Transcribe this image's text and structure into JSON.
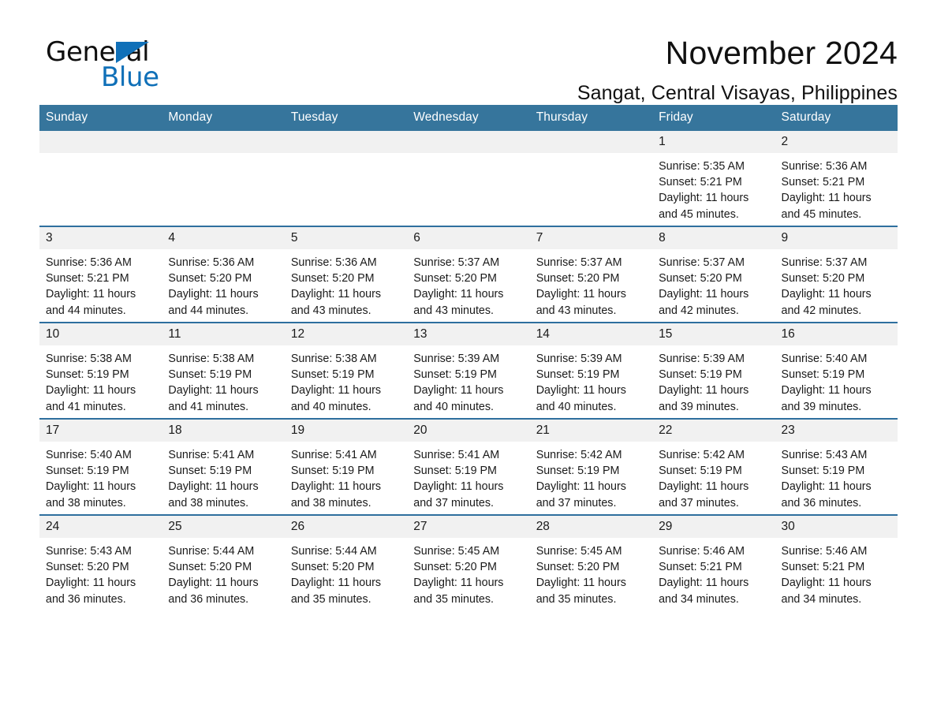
{
  "brand": {
    "name_part1": "General",
    "name_part2": "Blue",
    "accent_color": "#1070b8"
  },
  "header": {
    "title": "November 2024",
    "location": "Sangat, Central Visayas, Philippines"
  },
  "calendar": {
    "header_bg": "#36759c",
    "row_border_color": "#2e6f9e",
    "daynum_bg": "#f1f1f1",
    "weekdays": [
      "Sunday",
      "Monday",
      "Tuesday",
      "Wednesday",
      "Thursday",
      "Friday",
      "Saturday"
    ],
    "weeks": [
      [
        {
          "day": ""
        },
        {
          "day": ""
        },
        {
          "day": ""
        },
        {
          "day": ""
        },
        {
          "day": ""
        },
        {
          "day": "1",
          "sunrise": "Sunrise: 5:35 AM",
          "sunset": "Sunset: 5:21 PM",
          "daylight_line1": "Daylight: 11 hours",
          "daylight_line2": "and 45 minutes."
        },
        {
          "day": "2",
          "sunrise": "Sunrise: 5:36 AM",
          "sunset": "Sunset: 5:21 PM",
          "daylight_line1": "Daylight: 11 hours",
          "daylight_line2": "and 45 minutes."
        }
      ],
      [
        {
          "day": "3",
          "sunrise": "Sunrise: 5:36 AM",
          "sunset": "Sunset: 5:21 PM",
          "daylight_line1": "Daylight: 11 hours",
          "daylight_line2": "and 44 minutes."
        },
        {
          "day": "4",
          "sunrise": "Sunrise: 5:36 AM",
          "sunset": "Sunset: 5:20 PM",
          "daylight_line1": "Daylight: 11 hours",
          "daylight_line2": "and 44 minutes."
        },
        {
          "day": "5",
          "sunrise": "Sunrise: 5:36 AM",
          "sunset": "Sunset: 5:20 PM",
          "daylight_line1": "Daylight: 11 hours",
          "daylight_line2": "and 43 minutes."
        },
        {
          "day": "6",
          "sunrise": "Sunrise: 5:37 AM",
          "sunset": "Sunset: 5:20 PM",
          "daylight_line1": "Daylight: 11 hours",
          "daylight_line2": "and 43 minutes."
        },
        {
          "day": "7",
          "sunrise": "Sunrise: 5:37 AM",
          "sunset": "Sunset: 5:20 PM",
          "daylight_line1": "Daylight: 11 hours",
          "daylight_line2": "and 43 minutes."
        },
        {
          "day": "8",
          "sunrise": "Sunrise: 5:37 AM",
          "sunset": "Sunset: 5:20 PM",
          "daylight_line1": "Daylight: 11 hours",
          "daylight_line2": "and 42 minutes."
        },
        {
          "day": "9",
          "sunrise": "Sunrise: 5:37 AM",
          "sunset": "Sunset: 5:20 PM",
          "daylight_line1": "Daylight: 11 hours",
          "daylight_line2": "and 42 minutes."
        }
      ],
      [
        {
          "day": "10",
          "sunrise": "Sunrise: 5:38 AM",
          "sunset": "Sunset: 5:19 PM",
          "daylight_line1": "Daylight: 11 hours",
          "daylight_line2": "and 41 minutes."
        },
        {
          "day": "11",
          "sunrise": "Sunrise: 5:38 AM",
          "sunset": "Sunset: 5:19 PM",
          "daylight_line1": "Daylight: 11 hours",
          "daylight_line2": "and 41 minutes."
        },
        {
          "day": "12",
          "sunrise": "Sunrise: 5:38 AM",
          "sunset": "Sunset: 5:19 PM",
          "daylight_line1": "Daylight: 11 hours",
          "daylight_line2": "and 40 minutes."
        },
        {
          "day": "13",
          "sunrise": "Sunrise: 5:39 AM",
          "sunset": "Sunset: 5:19 PM",
          "daylight_line1": "Daylight: 11 hours",
          "daylight_line2": "and 40 minutes."
        },
        {
          "day": "14",
          "sunrise": "Sunrise: 5:39 AM",
          "sunset": "Sunset: 5:19 PM",
          "daylight_line1": "Daylight: 11 hours",
          "daylight_line2": "and 40 minutes."
        },
        {
          "day": "15",
          "sunrise": "Sunrise: 5:39 AM",
          "sunset": "Sunset: 5:19 PM",
          "daylight_line1": "Daylight: 11 hours",
          "daylight_line2": "and 39 minutes."
        },
        {
          "day": "16",
          "sunrise": "Sunrise: 5:40 AM",
          "sunset": "Sunset: 5:19 PM",
          "daylight_line1": "Daylight: 11 hours",
          "daylight_line2": "and 39 minutes."
        }
      ],
      [
        {
          "day": "17",
          "sunrise": "Sunrise: 5:40 AM",
          "sunset": "Sunset: 5:19 PM",
          "daylight_line1": "Daylight: 11 hours",
          "daylight_line2": "and 38 minutes."
        },
        {
          "day": "18",
          "sunrise": "Sunrise: 5:41 AM",
          "sunset": "Sunset: 5:19 PM",
          "daylight_line1": "Daylight: 11 hours",
          "daylight_line2": "and 38 minutes."
        },
        {
          "day": "19",
          "sunrise": "Sunrise: 5:41 AM",
          "sunset": "Sunset: 5:19 PM",
          "daylight_line1": "Daylight: 11 hours",
          "daylight_line2": "and 38 minutes."
        },
        {
          "day": "20",
          "sunrise": "Sunrise: 5:41 AM",
          "sunset": "Sunset: 5:19 PM",
          "daylight_line1": "Daylight: 11 hours",
          "daylight_line2": "and 37 minutes."
        },
        {
          "day": "21",
          "sunrise": "Sunrise: 5:42 AM",
          "sunset": "Sunset: 5:19 PM",
          "daylight_line1": "Daylight: 11 hours",
          "daylight_line2": "and 37 minutes."
        },
        {
          "day": "22",
          "sunrise": "Sunrise: 5:42 AM",
          "sunset": "Sunset: 5:19 PM",
          "daylight_line1": "Daylight: 11 hours",
          "daylight_line2": "and 37 minutes."
        },
        {
          "day": "23",
          "sunrise": "Sunrise: 5:43 AM",
          "sunset": "Sunset: 5:19 PM",
          "daylight_line1": "Daylight: 11 hours",
          "daylight_line2": "and 36 minutes."
        }
      ],
      [
        {
          "day": "24",
          "sunrise": "Sunrise: 5:43 AM",
          "sunset": "Sunset: 5:20 PM",
          "daylight_line1": "Daylight: 11 hours",
          "daylight_line2": "and 36 minutes."
        },
        {
          "day": "25",
          "sunrise": "Sunrise: 5:44 AM",
          "sunset": "Sunset: 5:20 PM",
          "daylight_line1": "Daylight: 11 hours",
          "daylight_line2": "and 36 minutes."
        },
        {
          "day": "26",
          "sunrise": "Sunrise: 5:44 AM",
          "sunset": "Sunset: 5:20 PM",
          "daylight_line1": "Daylight: 11 hours",
          "daylight_line2": "and 35 minutes."
        },
        {
          "day": "27",
          "sunrise": "Sunrise: 5:45 AM",
          "sunset": "Sunset: 5:20 PM",
          "daylight_line1": "Daylight: 11 hours",
          "daylight_line2": "and 35 minutes."
        },
        {
          "day": "28",
          "sunrise": "Sunrise: 5:45 AM",
          "sunset": "Sunset: 5:20 PM",
          "daylight_line1": "Daylight: 11 hours",
          "daylight_line2": "and 35 minutes."
        },
        {
          "day": "29",
          "sunrise": "Sunrise: 5:46 AM",
          "sunset": "Sunset: 5:21 PM",
          "daylight_line1": "Daylight: 11 hours",
          "daylight_line2": "and 34 minutes."
        },
        {
          "day": "30",
          "sunrise": "Sunrise: 5:46 AM",
          "sunset": "Sunset: 5:21 PM",
          "daylight_line1": "Daylight: 11 hours",
          "daylight_line2": "and 34 minutes."
        }
      ]
    ]
  }
}
